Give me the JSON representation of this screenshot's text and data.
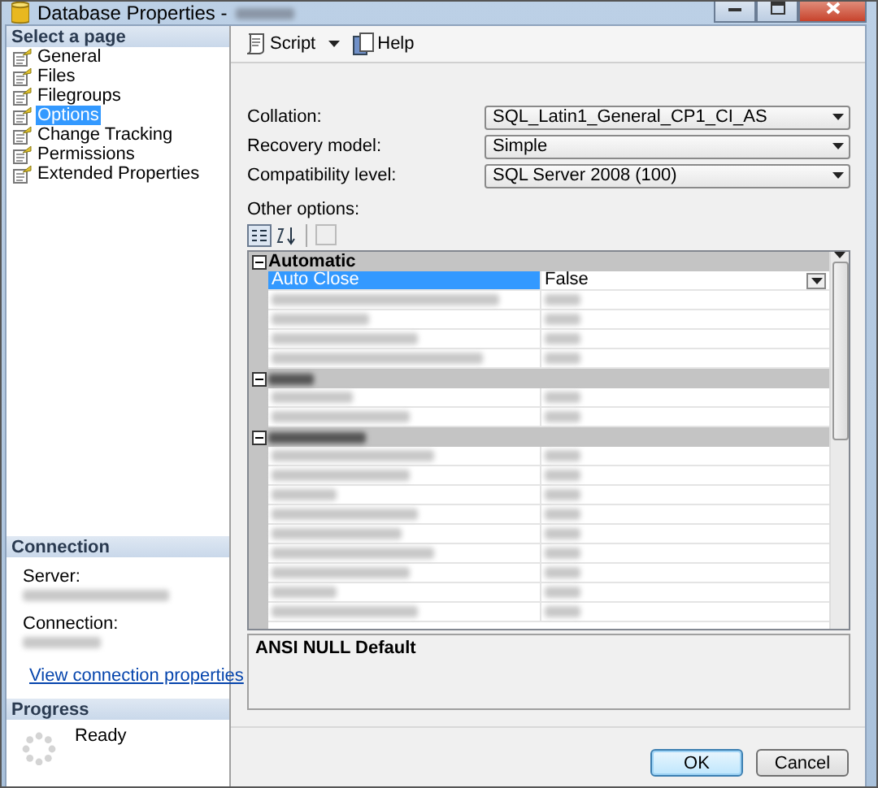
{
  "window": {
    "title": "Database Properties -"
  },
  "sidebar": {
    "header": "Select a page",
    "items": [
      {
        "label": "General",
        "selected": false
      },
      {
        "label": "Files",
        "selected": false
      },
      {
        "label": "Filegroups",
        "selected": false
      },
      {
        "label": "Options",
        "selected": true
      },
      {
        "label": "Change Tracking",
        "selected": false
      },
      {
        "label": "Permissions",
        "selected": false
      },
      {
        "label": "Extended Properties",
        "selected": false
      }
    ]
  },
  "connection": {
    "header": "Connection",
    "server_label": "Server:",
    "connection_label": "Connection:",
    "link": "View connection properties"
  },
  "progress": {
    "header": "Progress",
    "status": "Ready"
  },
  "toolbar": {
    "items": [
      {
        "label": "Script",
        "kind": "split"
      },
      {
        "label": "Help",
        "kind": "button"
      }
    ]
  },
  "fields": [
    {
      "label": "Collation:",
      "value": "SQL_Latin1_General_CP1_CI_AS"
    },
    {
      "label": "Recovery model:",
      "value": "Simple"
    },
    {
      "label": "Compatibility level:",
      "value": "SQL Server 2008 (100)"
    }
  ],
  "other_options_label": "Other options:",
  "grid": {
    "groups": [
      {
        "kind": "named",
        "name": "Automatic",
        "expanded": true,
        "rows": [
          {
            "kind": "text",
            "name": "Auto Close",
            "value": "False",
            "selected": true
          },
          {
            "kind": "redacted",
            "selected": false
          },
          {
            "kind": "redacted",
            "selected": false
          },
          {
            "kind": "redacted",
            "selected": false
          },
          {
            "kind": "redacted",
            "selected": false
          }
        ]
      },
      {
        "kind": "redacted",
        "expanded": true,
        "rows": [
          {
            "kind": "redacted",
            "selected": false
          },
          {
            "kind": "redacted",
            "selected": false
          }
        ]
      },
      {
        "kind": "redacted",
        "expanded": true,
        "rows": [
          {
            "kind": "redacted",
            "selected": false
          },
          {
            "kind": "redacted",
            "selected": false
          },
          {
            "kind": "redacted",
            "selected": false
          },
          {
            "kind": "redacted",
            "selected": false
          },
          {
            "kind": "redacted",
            "selected": false
          },
          {
            "kind": "redacted",
            "selected": false
          },
          {
            "kind": "redacted",
            "selected": false
          },
          {
            "kind": "redacted",
            "selected": false
          },
          {
            "kind": "redacted",
            "selected": false
          }
        ]
      }
    ]
  },
  "description": {
    "title": "ANSI NULL Default"
  },
  "buttons": [
    {
      "label": "OK",
      "default": true
    },
    {
      "label": "Cancel",
      "default": false
    }
  ]
}
